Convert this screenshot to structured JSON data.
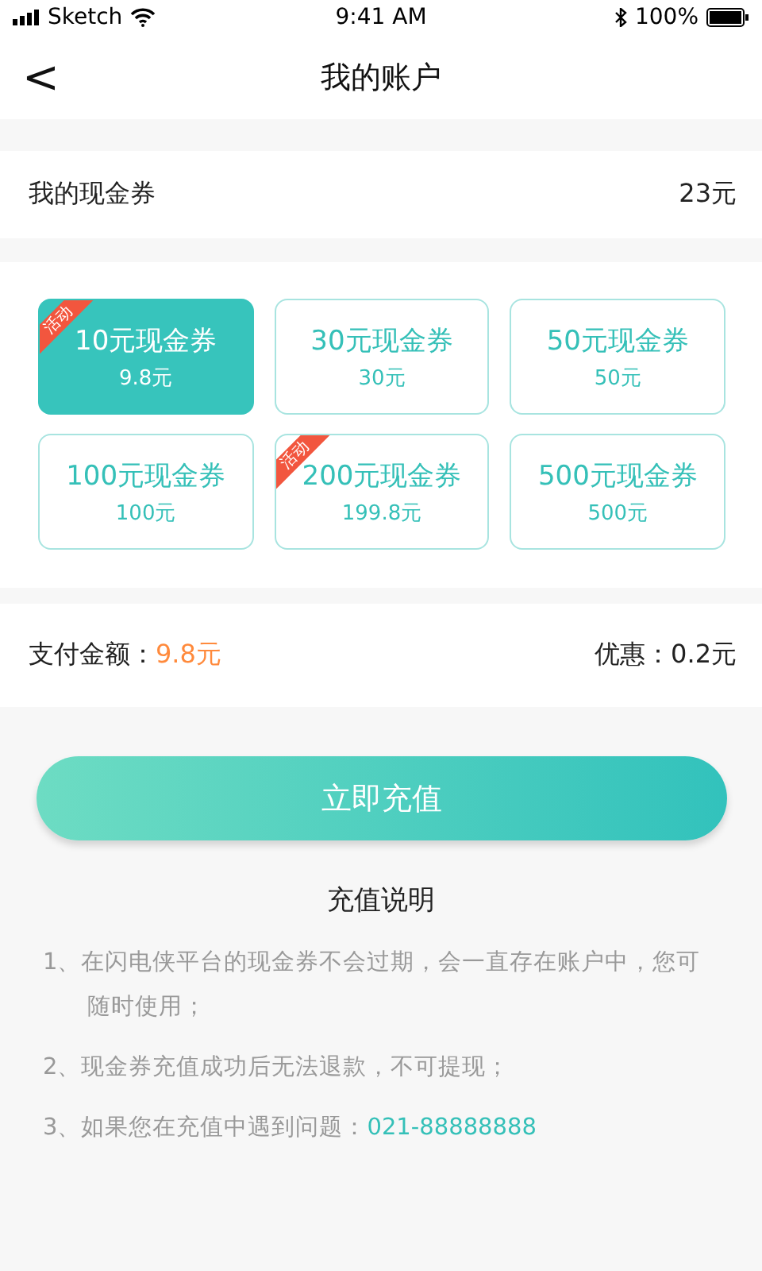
{
  "status_bar": {
    "carrier": "Sketch",
    "time": "9:41 AM",
    "battery": "100%"
  },
  "nav": {
    "back": "<",
    "title": "我的账户"
  },
  "balance": {
    "label": "我的现金券",
    "value": "23元"
  },
  "coupons": [
    {
      "title": "10元现金券",
      "price": "9.8元",
      "selected": true,
      "badge": "活动"
    },
    {
      "title": "30元现金券",
      "price": "30元",
      "selected": false
    },
    {
      "title": "50元现金券",
      "price": "50元",
      "selected": false
    },
    {
      "title": "100元现金券",
      "price": "100元",
      "selected": false
    },
    {
      "title": "200元现金券",
      "price": "199.8元",
      "selected": false,
      "badge": "活动"
    },
    {
      "title": "500元现金券",
      "price": "500元",
      "selected": false
    }
  ],
  "payment": {
    "label": "支付金额：",
    "amount": "9.8元",
    "discount_label": "优惠：",
    "discount": "0.2元"
  },
  "submit": "立即充值",
  "notes": {
    "title": "充值说明",
    "items": [
      {
        "text": "1、在闪电侠平台的现金券不会过期，会一直存在账户中，您可随时使用；"
      },
      {
        "text": "2、现金券充值成功后无法退款，不可提现；"
      },
      {
        "text": "3、如果您在充值中遇到问题：",
        "phone": "021-88888888"
      }
    ]
  }
}
